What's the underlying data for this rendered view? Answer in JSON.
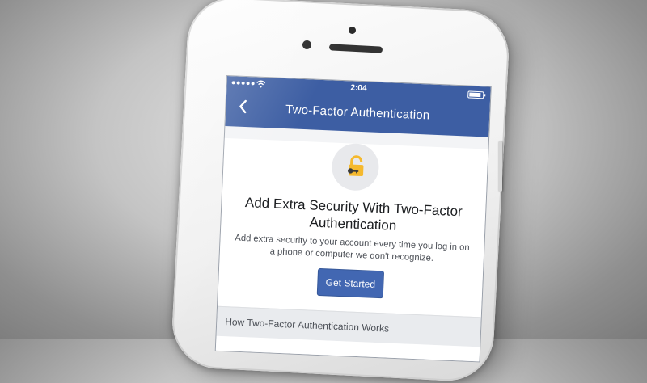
{
  "status_bar": {
    "time": "2:04"
  },
  "nav": {
    "title": "Two-Factor Authentication",
    "back_icon": "chevron-left-icon"
  },
  "hero": {
    "icon": "padlock-key-icon",
    "headline": "Add Extra Security With Two-Factor Authentication",
    "description": "Add extra security to your account every time you log in on a phone or computer we don't recognize.",
    "button_label": "Get Started"
  },
  "section": {
    "title": "How Two-Factor Authentication Works"
  },
  "colors": {
    "brand_blue": "#3d5ea3",
    "button_blue": "#4267b2",
    "lock_gold": "#f5b92e"
  }
}
